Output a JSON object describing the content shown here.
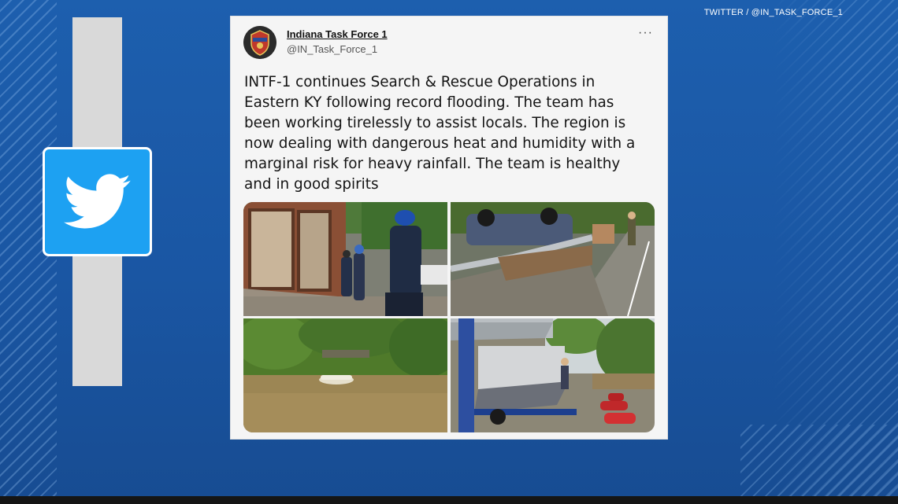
{
  "broadcast": {
    "credit": "TWITTER / @IN_TASK_FORCE_1",
    "brand_color": "#1da1f2",
    "background_color": "#1a56a3"
  },
  "twitter_tile": {
    "icon": "twitter-bird-icon"
  },
  "tweet": {
    "author_name": "Indiana Task Force 1",
    "author_handle": "@IN_Task_Force_1",
    "more_label": "···",
    "text": "INTF-1 continues Search & Rescue Operations in\nEastern KY following record flooding. The team has\nbeen working tirelessly to assist locals. The region is\nnow dealing with dangerous heat and humidity with a\nmarginal risk for heavy rainfall.  The team is healthy\nand in good spirits",
    "media": [
      {
        "icon": "photo-rescuers-at-damaged-building"
      },
      {
        "icon": "photo-overturned-car-on-guardrail"
      },
      {
        "icon": "photo-submerged-car-in-river"
      },
      {
        "icon": "photo-rescue-boat-on-trailer"
      }
    ]
  }
}
